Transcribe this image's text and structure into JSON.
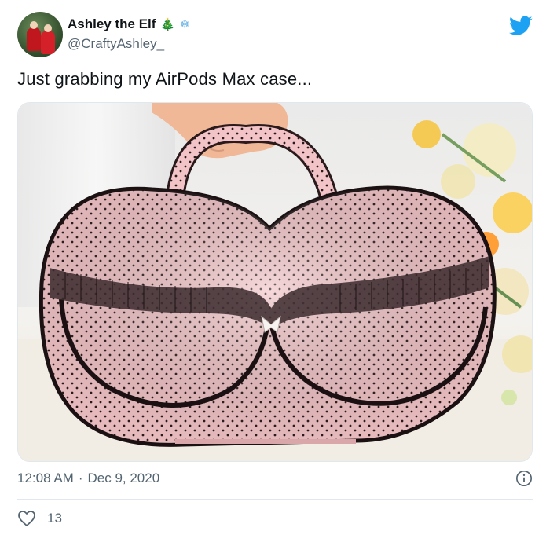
{
  "author": {
    "display_name": "Ashley the Elf",
    "emojis": [
      "🎄",
      "❄"
    ],
    "handle": "@CraftyAshley_",
    "avatar_icon": "avatar-photo"
  },
  "tweet": {
    "text": "Just grabbing my AirPods Max case...",
    "media_description_icon": "photo-pink-polka-dot-case"
  },
  "meta": {
    "time": "12:08 AM",
    "separator": "·",
    "date": "Dec 9, 2020"
  },
  "engagement": {
    "likes": "13"
  },
  "colors": {
    "twitter_blue": "#1da1f2",
    "secondary_text": "#536471",
    "divider": "#e1e8ed"
  },
  "icons": {
    "logo": "twitter-bird-icon",
    "info": "info-icon",
    "like": "heart-icon"
  }
}
